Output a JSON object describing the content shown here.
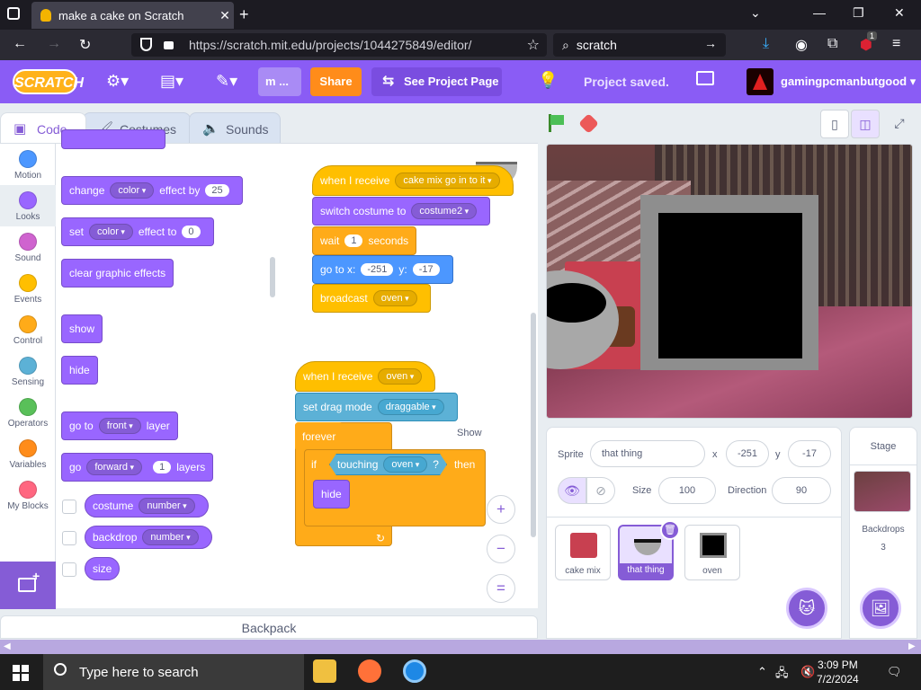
{
  "browser": {
    "tab_title": "make a cake on Scratch",
    "url": "https://scratch.mit.edu/projects/1044275849/editor/",
    "search_text": "scratch",
    "ext_badge": "1"
  },
  "menubar": {
    "logo": "SCRATCH",
    "title_abbrev": "m ...",
    "share_label": "Share",
    "see_project_label": "See Project Page",
    "status": "Project saved.",
    "username": "gamingpcmanbutgood"
  },
  "editor_tabs": [
    "Code",
    "Costumes",
    "Sounds"
  ],
  "categories": [
    {
      "label": "Motion",
      "color": "#4c97ff"
    },
    {
      "label": "Looks",
      "color": "#9966ff"
    },
    {
      "label": "Sound",
      "color": "#cf63cf"
    },
    {
      "label": "Events",
      "color": "#ffbf00"
    },
    {
      "label": "Control",
      "color": "#ffab19"
    },
    {
      "label": "Sensing",
      "color": "#5cb1d6"
    },
    {
      "label": "Operators",
      "color": "#59c059"
    },
    {
      "label": "Variables",
      "color": "#ff8c1a"
    },
    {
      "label": "My Blocks",
      "color": "#ff6680"
    }
  ],
  "palette": {
    "change_effect": {
      "w1": "change",
      "dd": "color",
      "w2": "effect by",
      "val": "25"
    },
    "set_effect": {
      "w1": "set",
      "dd": "color",
      "w2": "effect to",
      "val": "0"
    },
    "clear_effects": "clear graphic effects",
    "show": "show",
    "hide": "hide",
    "go_to_layer": {
      "w1": "go to",
      "dd": "front",
      "w2": "layer"
    },
    "go_layers": {
      "w1": "go",
      "dd": "forward",
      "val": "1",
      "w2": "layers"
    },
    "costume_reporter": {
      "label": "costume",
      "dd": "number"
    },
    "backdrop_reporter": {
      "label": "backdrop",
      "dd": "number"
    },
    "size_reporter": "size"
  },
  "script1": {
    "when_receive": {
      "label": "when I receive",
      "dd": "cake mix go in to it"
    },
    "switch_costume": {
      "label": "switch costume to",
      "dd": "costume2"
    },
    "wait": {
      "w1": "wait",
      "val": "1",
      "w2": "seconds"
    },
    "goto_xy": {
      "w1": "go to x:",
      "x": "-251",
      "w2": "y:",
      "y": "-17"
    },
    "broadcast": {
      "label": "broadcast",
      "dd": "oven"
    }
  },
  "script2": {
    "when_receive": {
      "label": "when I receive",
      "dd": "oven"
    },
    "drag_mode": {
      "label": "set drag mode",
      "dd": "draggable"
    },
    "forever": "forever",
    "if": {
      "w1": "if",
      "w2": "then"
    },
    "touching": {
      "label": "touching",
      "dd": "oven",
      "q": "?"
    },
    "hide": "hide"
  },
  "zoom": {
    "in": "+",
    "out": "−",
    "reset": "="
  },
  "backpack": "Backpack",
  "sprite_info": {
    "sprite_label": "Sprite",
    "sprite_name": "that thing",
    "x_label": "x",
    "x": "-251",
    "y_label": "y",
    "y": "-17",
    "show_label": "Show",
    "size_label": "Size",
    "size": "100",
    "direction_label": "Direction",
    "direction": "90"
  },
  "sprites": [
    {
      "name": "cake mix"
    },
    {
      "name": "that thing"
    },
    {
      "name": "oven"
    }
  ],
  "stage_pane": {
    "title": "Stage",
    "backdrops_label": "Backdrops",
    "backdrops_count": "3"
  },
  "taskbar": {
    "search_placeholder": "Type here to search",
    "time": "3:09 PM",
    "date": "7/2/2024"
  }
}
